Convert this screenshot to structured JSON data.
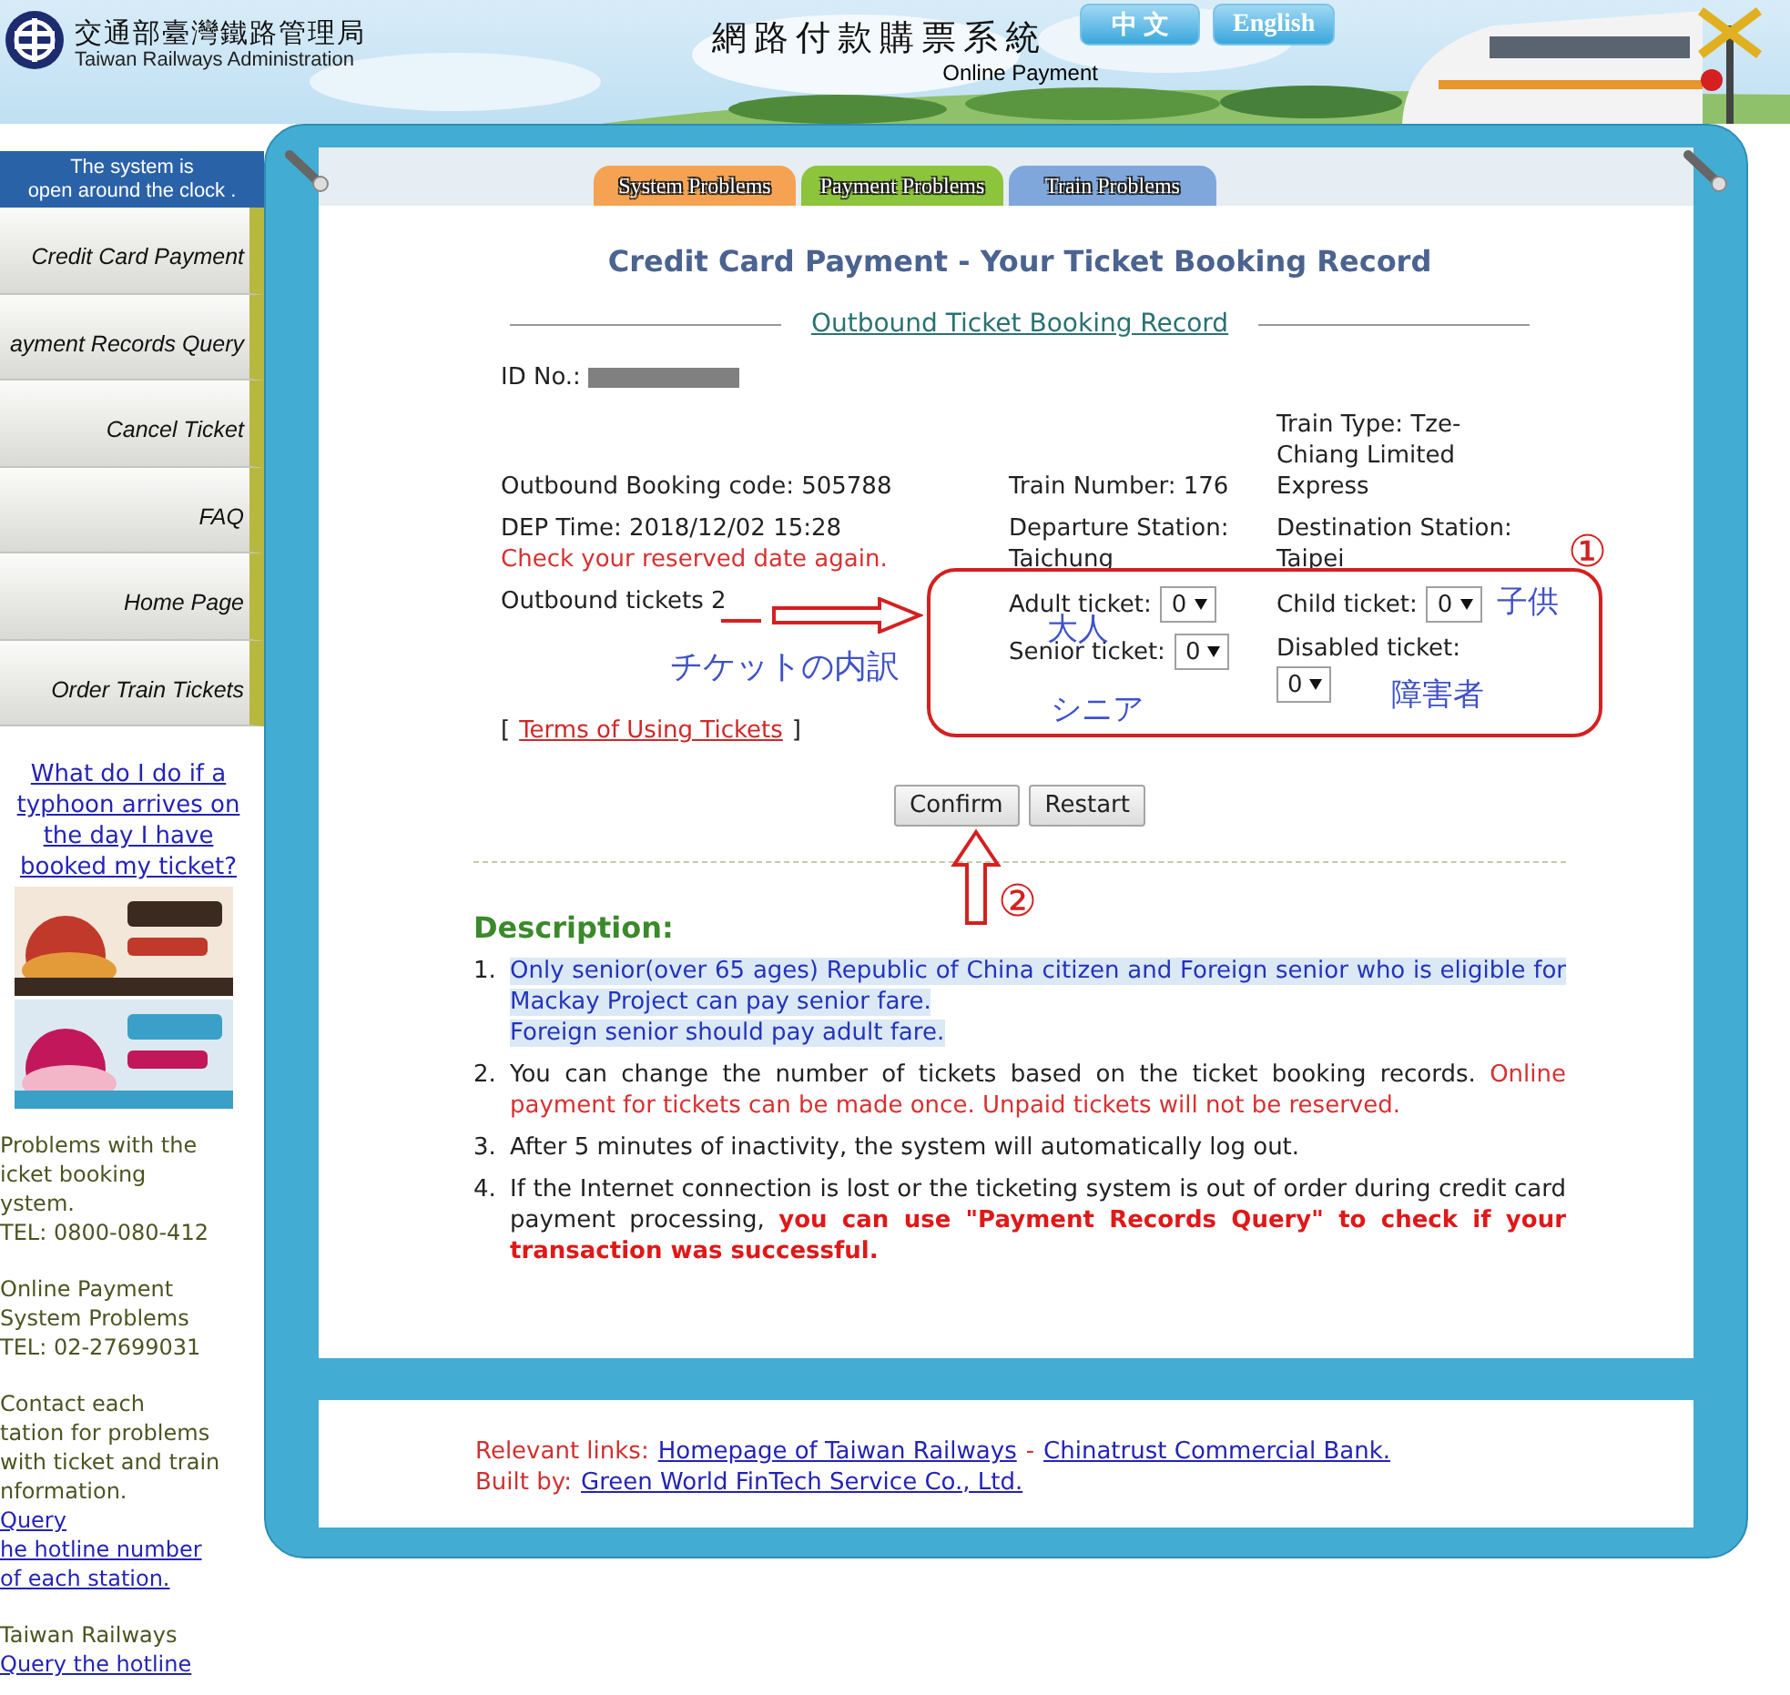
{
  "header": {
    "agency_name": "交通部臺灣鐵路管理局",
    "agency_name_en": "Taiwan Railways Administration",
    "system_title": "網路付款購票系統",
    "system_subtitle": "Online Payment",
    "language_buttons": [
      "中 文",
      "English"
    ]
  },
  "sidebar": {
    "notice": "The system is\nopen around the clock .",
    "menu": [
      "Credit Card Payment",
      "ayment Records Query",
      "Cancel Ticket",
      "FAQ",
      "Home Page",
      "Order Train Tickets"
    ],
    "help_link": "What do I do if a typhoon arrives on the day I have booked my ticket?",
    "contacts": [
      {
        "text": "Problems with the\nicket booking\nystem.\nTEL: 0800-080-412"
      },
      {
        "text": "Online Payment\nSystem Problems\nTEL: 02-27699031"
      },
      {
        "text": "Contact each\ntation for problems\nwith ticket and train\nnformation.",
        "link": "Query\nhe hotline number\nof each station."
      },
      {
        "text": "Taiwan Railways",
        "link": "Query the hotline"
      }
    ]
  },
  "tabs": [
    {
      "label": "System Problems",
      "color": "#f5a352"
    },
    {
      "label": "Payment Problems",
      "color": "#8cc43c"
    },
    {
      "label": "Train Problems",
      "color": "#7fa7dc"
    }
  ],
  "content": {
    "title": "Credit Card Payment - Your Ticket Booking Record",
    "section_link": "Outbound Ticket Booking Record",
    "id_label": "ID No.:",
    "booking_code": "Outbound Booking code: 505788",
    "train_number": "Train Number: 176",
    "train_type": "Train Type: Tze-Chiang Limited Express",
    "dep_time": "DEP Time: 2018/12/02 15:28",
    "date_warning": "Check your reserved date again.",
    "departure": "Departure Station: Taichung",
    "destination": "Destination Station: Taipei",
    "tickets_label": "Outbound tickets 2",
    "tickets": [
      {
        "label": "Adult ticket:",
        "value": "0"
      },
      {
        "label": "Child ticket:",
        "value": "0"
      },
      {
        "label": "Senior ticket:",
        "value": "0"
      },
      {
        "label": "Disabled ticket:",
        "value": "0"
      }
    ],
    "terms_open": "[",
    "terms_link": "Terms of Using Tickets",
    "terms_close": "]",
    "buttons": [
      "Confirm",
      "Restart"
    ],
    "description_heading": "Description:",
    "description": [
      {
        "number": "1.",
        "parts": [
          {
            "kind": "highlight",
            "text": "Only senior(over 65 ages) Republic of China citizen and Foreign senior who is eligible for Mackay Project can pay senior fare.\nForeign senior should pay adult fare."
          }
        ]
      },
      {
        "number": "2.",
        "parts": [
          {
            "kind": "plain",
            "text": "You can change the number of tickets based on the ticket booking records. "
          },
          {
            "kind": "warning",
            "text": "Online payment for tickets can be made once. Unpaid tickets will not be reserved."
          }
        ]
      },
      {
        "number": "3.",
        "parts": [
          {
            "kind": "plain",
            "text": "After 5 minutes of inactivity, the system will automatically log out."
          }
        ]
      },
      {
        "number": "4.",
        "parts": [
          {
            "kind": "plain",
            "text": "If the Internet connection is lost or the ticketing system is out of order during credit card payment processing, "
          },
          {
            "kind": "strong-warning",
            "text": "you can use \"Payment Records Query\" to check if your transaction was successful."
          }
        ]
      }
    ]
  },
  "footer": {
    "links_label": "Relevant links:",
    "links": [
      "Homepage of Taiwan Railways",
      "Chinatrust Commercial Bank."
    ],
    "separator": "-",
    "built_label": "Built by:",
    "built_link": "Green World FinTech Service Co., Ltd."
  },
  "annotations": {
    "markers": [
      "①",
      "②"
    ],
    "notes": [
      "大人",
      "子供",
      "チケットの内訳",
      "シニア",
      "障害者"
    ]
  }
}
